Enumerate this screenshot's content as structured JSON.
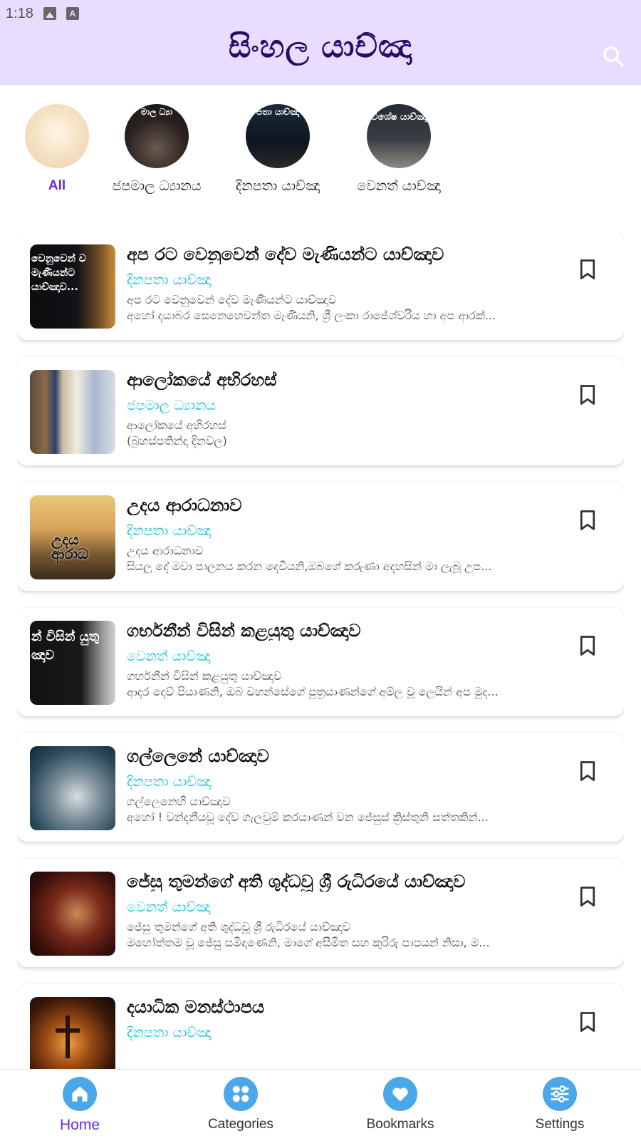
{
  "status_bar": {
    "time": "1:18"
  },
  "app_bar": {
    "title": "සිංහල යාච්ඤා"
  },
  "categories": [
    {
      "label": "All",
      "thumb_text": ""
    },
    {
      "label": "ජපමාල ධ්‍යානය",
      "thumb_text": "මාල ධ්‍යා"
    },
    {
      "label": "දිනපතා යාච්ඤා",
      "thumb_text": "පතා යාච්ඤා"
    },
    {
      "label": "වෙනත් යාච්ඤා",
      "thumb_text": "විශේෂ යාච්ඤා"
    }
  ],
  "prayers": [
    {
      "title": "අප රට වෙනුවෙන් දේව මැණියන්ට යාච්ඤාව",
      "category": "දිනපතා යාච්ඤා",
      "line1": "අප රට වෙනුවෙන් දේව මැණියන්ට යාච්ඤාව",
      "line2": "අහෝ දයාබර සෙනෙහෙවන්ත මැණියනි, ශ්‍රී ලංකා රාජේශ්වරිය හා අප ආරක්...",
      "thumb_text": "වෙනුවෙන් ව මැණියන්ට යාච්ඤාව..."
    },
    {
      "title": "ආලෝකයේ අභිරහස්",
      "category": "ජපමාල ධ්‍යානය",
      "line1": "ආලෝකයේ අභිරහස්",
      "line2": "(බ්‍රහස්පතින්දා දිනවල)",
      "thumb_text": ""
    },
    {
      "title": "උදය ආරාධනාව",
      "category": "දිනපතා යාච්ඤා",
      "line1": "උදය ආරාධනාව",
      "line2": "සියලු දේ මවා පාලනය කරන දෙවියනි,ඔබගේ කරුණා අදහසින් මා ලැබූ උප...",
      "thumb_text": "උදය ආරාධ"
    },
    {
      "title": "ගර්භනීන් විසින් කළයුතු යාච්ඤාව",
      "category": "වෙනත් යාච්ඤා",
      "line1": "ගර්භනීන් විසින් කළයුතු යාච්ඤාව",
      "line2": "ආදර දෙව් පියාණනි, ඔබ වහන්සේගේ පුත්‍රයාණන්ගේ අම්ල වූ ලෙයින් අප මුද...",
      "thumb_text": "න් විසින් යුතු ඤාව"
    },
    {
      "title": "ගල්ලෙනේ යාච්ඤාව",
      "category": "දිනපතා යාච්ඤා",
      "line1": "ගල්ලෙනෙහි යාච්ඤාව",
      "line2": "අහෝ ! වන්දනීයවූ දේව ගැලවුම් කරයාණන් වන ජේසුස් ක්‍රිස්තුනි සත්තකින්...",
      "thumb_text": ""
    },
    {
      "title": "ජේසු තුමන්ගේ අති ශුද්ධවූ ශ්‍රී රුධිරයේ යාච්ඤාව",
      "category": "වෙනත් යාච්ඤා",
      "line1": "ජේසු තුමන්ගේ අති ශුද්ධවූ ශ්‍රී රුධිරයේ යාච්ඤාව",
      "line2": "මහෝත්තම වූ ජේසු සමිඳාණෙනි, මාගේ අසීමිත සහ කුරිරු පාපයන් නිසා, ම...",
      "thumb_text": ""
    },
    {
      "title": "දයාධික මනස්ථාපය",
      "category": "දිනපතා යාච්ඤා",
      "line1": "",
      "line2": "",
      "thumb_text": ""
    }
  ],
  "bottom_nav": [
    {
      "label": "Home",
      "icon": "home-icon",
      "active": true
    },
    {
      "label": "Categories",
      "icon": "grid-icon",
      "active": false
    },
    {
      "label": "Bookmarks",
      "icon": "heart-icon",
      "active": false
    },
    {
      "label": "Settings",
      "icon": "sliders-icon",
      "active": false
    }
  ],
  "colors": {
    "app_bar": "#e9ddff",
    "title": "#2a0b68",
    "accent": "#6c2bd9",
    "category_text": "#19c1d6",
    "nav_bubble": "#4aa8ea"
  }
}
